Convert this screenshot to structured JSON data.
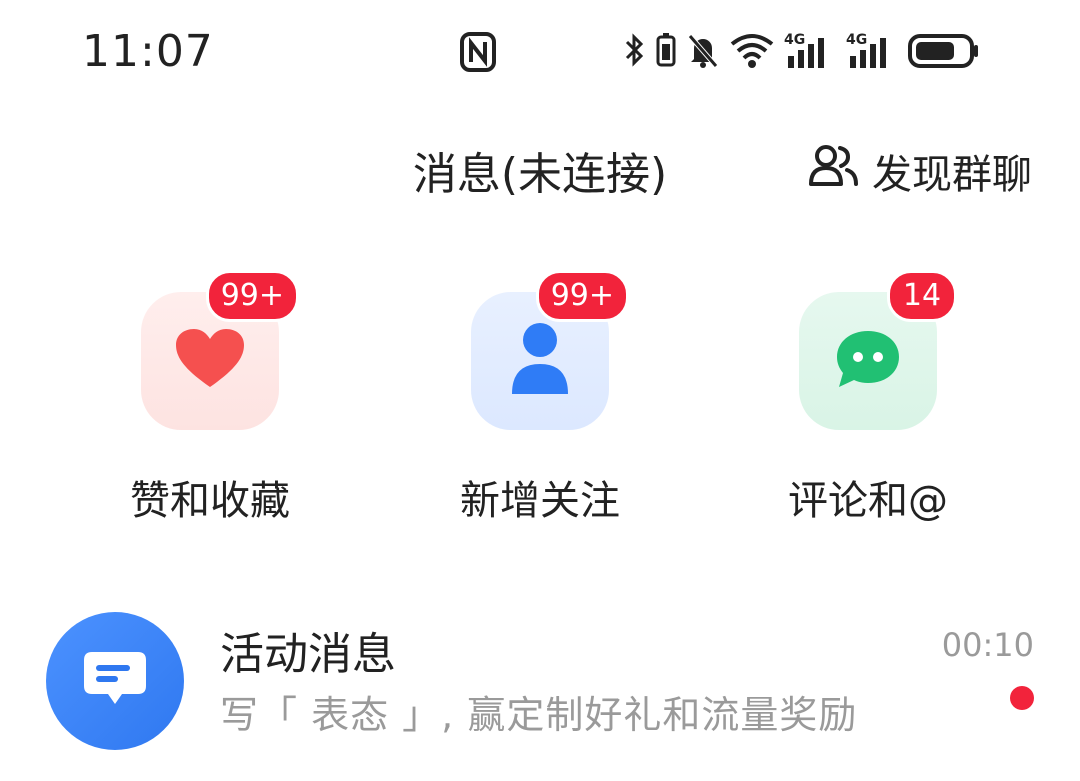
{
  "status_bar": {
    "time": "11:07",
    "icons": [
      "nfc-icon",
      "bluetooth-icon",
      "battery-saver-icon",
      "mute-icon",
      "wifi-icon",
      "signal-4g-icon",
      "signal-4g-icon",
      "battery-icon"
    ],
    "net_label_1": "4G",
    "net_label_2": "4G"
  },
  "header": {
    "title": "消息(未连接)",
    "discover_label": "发现群聊"
  },
  "quick_actions": [
    {
      "label": "赞和收藏",
      "badge": "99+",
      "icon": "heart-icon",
      "color": "#f5504f"
    },
    {
      "label": "新增关注",
      "badge": "99+",
      "icon": "person-icon",
      "color": "#2f7cf6"
    },
    {
      "label": "评论和@",
      "badge": "14",
      "icon": "chat-bubble-icon",
      "color": "#21c073"
    }
  ],
  "messages": [
    {
      "title": "活动消息",
      "subtitle": "写「 表态 」, 赢定制好礼和流量奖励",
      "time": "00:10",
      "unread": true,
      "icon": "message-icon"
    }
  ],
  "colors": {
    "badge": "#f2233b",
    "text": "#222222",
    "muted": "#9a9a9a"
  }
}
